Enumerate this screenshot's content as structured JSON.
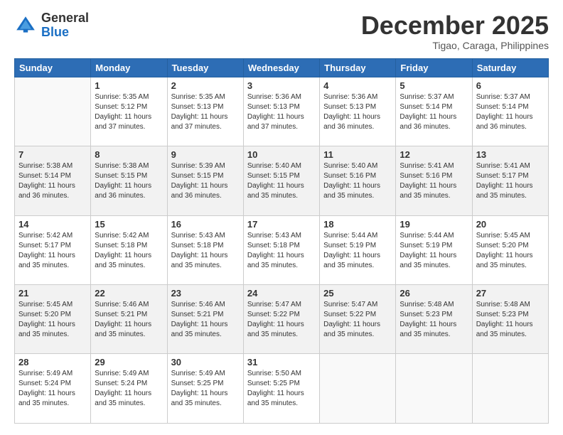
{
  "logo": {
    "general": "General",
    "blue": "Blue"
  },
  "header": {
    "month": "December 2025",
    "location": "Tigao, Caraga, Philippines"
  },
  "weekdays": [
    "Sunday",
    "Monday",
    "Tuesday",
    "Wednesday",
    "Thursday",
    "Friday",
    "Saturday"
  ],
  "weeks": [
    [
      {
        "num": "",
        "info": ""
      },
      {
        "num": "1",
        "info": "Sunrise: 5:35 AM\nSunset: 5:12 PM\nDaylight: 11 hours\nand 37 minutes."
      },
      {
        "num": "2",
        "info": "Sunrise: 5:35 AM\nSunset: 5:13 PM\nDaylight: 11 hours\nand 37 minutes."
      },
      {
        "num": "3",
        "info": "Sunrise: 5:36 AM\nSunset: 5:13 PM\nDaylight: 11 hours\nand 37 minutes."
      },
      {
        "num": "4",
        "info": "Sunrise: 5:36 AM\nSunset: 5:13 PM\nDaylight: 11 hours\nand 36 minutes."
      },
      {
        "num": "5",
        "info": "Sunrise: 5:37 AM\nSunset: 5:14 PM\nDaylight: 11 hours\nand 36 minutes."
      },
      {
        "num": "6",
        "info": "Sunrise: 5:37 AM\nSunset: 5:14 PM\nDaylight: 11 hours\nand 36 minutes."
      }
    ],
    [
      {
        "num": "7",
        "info": "Sunrise: 5:38 AM\nSunset: 5:14 PM\nDaylight: 11 hours\nand 36 minutes."
      },
      {
        "num": "8",
        "info": "Sunrise: 5:38 AM\nSunset: 5:15 PM\nDaylight: 11 hours\nand 36 minutes."
      },
      {
        "num": "9",
        "info": "Sunrise: 5:39 AM\nSunset: 5:15 PM\nDaylight: 11 hours\nand 36 minutes."
      },
      {
        "num": "10",
        "info": "Sunrise: 5:40 AM\nSunset: 5:15 PM\nDaylight: 11 hours\nand 35 minutes."
      },
      {
        "num": "11",
        "info": "Sunrise: 5:40 AM\nSunset: 5:16 PM\nDaylight: 11 hours\nand 35 minutes."
      },
      {
        "num": "12",
        "info": "Sunrise: 5:41 AM\nSunset: 5:16 PM\nDaylight: 11 hours\nand 35 minutes."
      },
      {
        "num": "13",
        "info": "Sunrise: 5:41 AM\nSunset: 5:17 PM\nDaylight: 11 hours\nand 35 minutes."
      }
    ],
    [
      {
        "num": "14",
        "info": "Sunrise: 5:42 AM\nSunset: 5:17 PM\nDaylight: 11 hours\nand 35 minutes."
      },
      {
        "num": "15",
        "info": "Sunrise: 5:42 AM\nSunset: 5:18 PM\nDaylight: 11 hours\nand 35 minutes."
      },
      {
        "num": "16",
        "info": "Sunrise: 5:43 AM\nSunset: 5:18 PM\nDaylight: 11 hours\nand 35 minutes."
      },
      {
        "num": "17",
        "info": "Sunrise: 5:43 AM\nSunset: 5:18 PM\nDaylight: 11 hours\nand 35 minutes."
      },
      {
        "num": "18",
        "info": "Sunrise: 5:44 AM\nSunset: 5:19 PM\nDaylight: 11 hours\nand 35 minutes."
      },
      {
        "num": "19",
        "info": "Sunrise: 5:44 AM\nSunset: 5:19 PM\nDaylight: 11 hours\nand 35 minutes."
      },
      {
        "num": "20",
        "info": "Sunrise: 5:45 AM\nSunset: 5:20 PM\nDaylight: 11 hours\nand 35 minutes."
      }
    ],
    [
      {
        "num": "21",
        "info": "Sunrise: 5:45 AM\nSunset: 5:20 PM\nDaylight: 11 hours\nand 35 minutes."
      },
      {
        "num": "22",
        "info": "Sunrise: 5:46 AM\nSunset: 5:21 PM\nDaylight: 11 hours\nand 35 minutes."
      },
      {
        "num": "23",
        "info": "Sunrise: 5:46 AM\nSunset: 5:21 PM\nDaylight: 11 hours\nand 35 minutes."
      },
      {
        "num": "24",
        "info": "Sunrise: 5:47 AM\nSunset: 5:22 PM\nDaylight: 11 hours\nand 35 minutes."
      },
      {
        "num": "25",
        "info": "Sunrise: 5:47 AM\nSunset: 5:22 PM\nDaylight: 11 hours\nand 35 minutes."
      },
      {
        "num": "26",
        "info": "Sunrise: 5:48 AM\nSunset: 5:23 PM\nDaylight: 11 hours\nand 35 minutes."
      },
      {
        "num": "27",
        "info": "Sunrise: 5:48 AM\nSunset: 5:23 PM\nDaylight: 11 hours\nand 35 minutes."
      }
    ],
    [
      {
        "num": "28",
        "info": "Sunrise: 5:49 AM\nSunset: 5:24 PM\nDaylight: 11 hours\nand 35 minutes."
      },
      {
        "num": "29",
        "info": "Sunrise: 5:49 AM\nSunset: 5:24 PM\nDaylight: 11 hours\nand 35 minutes."
      },
      {
        "num": "30",
        "info": "Sunrise: 5:49 AM\nSunset: 5:25 PM\nDaylight: 11 hours\nand 35 minutes."
      },
      {
        "num": "31",
        "info": "Sunrise: 5:50 AM\nSunset: 5:25 PM\nDaylight: 11 hours\nand 35 minutes."
      },
      {
        "num": "",
        "info": ""
      },
      {
        "num": "",
        "info": ""
      },
      {
        "num": "",
        "info": ""
      }
    ]
  ]
}
